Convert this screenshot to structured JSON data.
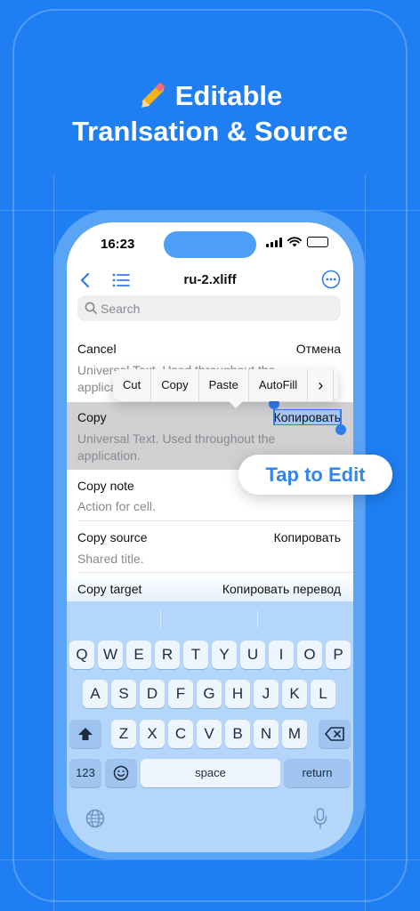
{
  "hero": {
    "line1": "Editable",
    "line2": "Tranlsation & Source",
    "icon": "pencil-icon"
  },
  "status": {
    "time": "16:23"
  },
  "nav": {
    "title": "ru-2.xliff"
  },
  "search": {
    "placeholder": "Search"
  },
  "rows": [
    {
      "key": "Cancel",
      "value": "Отмена",
      "note": "Universal Text. Used throughout the application."
    },
    {
      "key": "Copy",
      "value": "Копировать",
      "note": "Universal Text. Used throughout the application."
    },
    {
      "key": "Copy note",
      "value": "",
      "note": "Action for cell."
    },
    {
      "key": "Copy source",
      "value": "Копировать",
      "note": "Shared title."
    },
    {
      "key": "Copy target",
      "value": "Копировать перевод",
      "note": ""
    }
  ],
  "edit_menu": {
    "items": [
      "Cut",
      "Copy",
      "Paste",
      "AutoFill"
    ],
    "more": "›"
  },
  "callout": {
    "label": "Tap to Edit"
  },
  "keyboard": {
    "row1": [
      "Q",
      "W",
      "E",
      "R",
      "T",
      "Y",
      "U",
      "I",
      "O",
      "P"
    ],
    "row2": [
      "A",
      "S",
      "D",
      "F",
      "G",
      "H",
      "J",
      "K",
      "L"
    ],
    "row3": [
      "Z",
      "X",
      "C",
      "V",
      "B",
      "N",
      "M"
    ],
    "numbers": "123",
    "space": "space",
    "return": "return"
  },
  "colors": {
    "background": "#1f7ff2",
    "accent": "#2f7cf0",
    "keyboard": "#b4d6fa"
  }
}
